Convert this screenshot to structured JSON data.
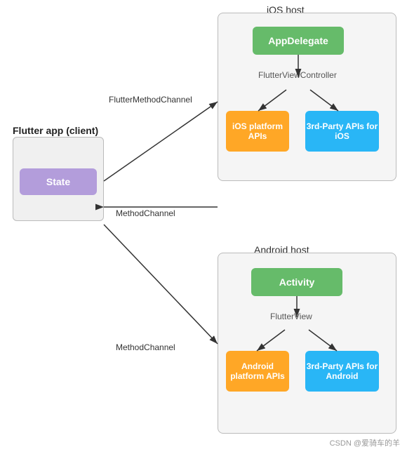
{
  "labels": {
    "ios_host": "iOS host",
    "android_host": "Android host",
    "flutter_client": "Flutter app (client)",
    "state": "State",
    "app_delegate": "AppDelegate",
    "flutter_view_controller": "FlutterViewController",
    "ios_platform_apis": "iOS platform APIs",
    "third_party_ios": "3rd-Party APIs for iOS",
    "activity": "Activity",
    "flutter_view": "FlutterView",
    "android_platform_apis": "Android platform APIs",
    "third_party_android": "3rd-Party APIs for Android",
    "flutter_method_channel": "FlutterMethodChannel",
    "method_channel_1": "MethodChannel",
    "method_channel_2": "MethodChannel",
    "watermark": "CSDN @爱骑车的羊"
  }
}
